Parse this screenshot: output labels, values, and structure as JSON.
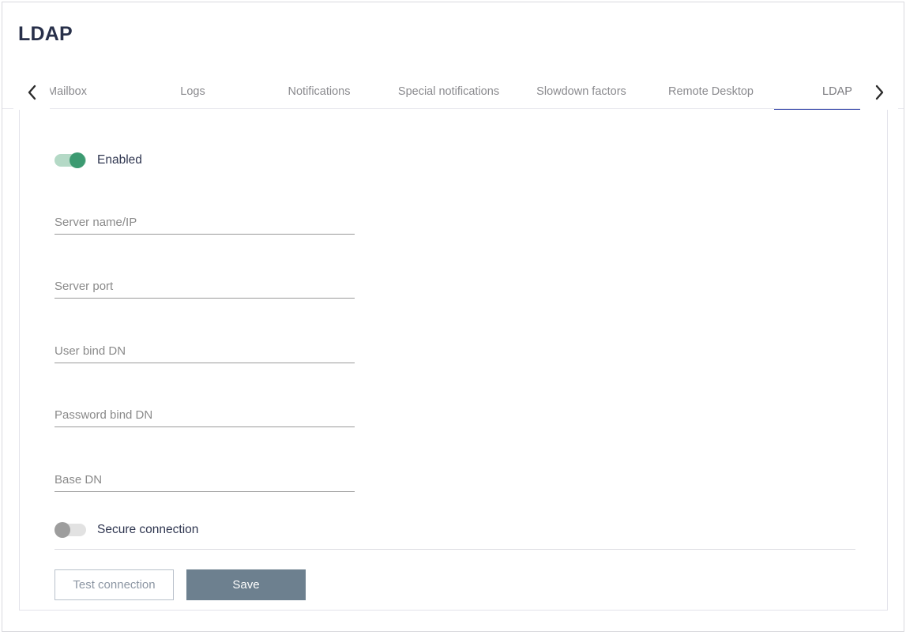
{
  "page": {
    "title": "LDAP"
  },
  "tabbar": {
    "prev_icon": "chevron-left-icon",
    "next_icon": "chevron-right-icon",
    "active_tab": "LDAP",
    "tabs": [
      {
        "label": "Mailbox",
        "active": false
      },
      {
        "label": "Logs",
        "active": false
      },
      {
        "label": "Notifications",
        "active": false
      },
      {
        "label": "Special notifications",
        "active": false
      },
      {
        "label": "Slowdown factors",
        "active": false
      },
      {
        "label": "Remote Desktop",
        "active": false
      },
      {
        "label": "LDAP",
        "active": true
      }
    ]
  },
  "form": {
    "enabled_toggle": {
      "label": "Enabled",
      "state": "on"
    },
    "secure_toggle": {
      "label": "Secure connection",
      "state": "off"
    },
    "fields": [
      {
        "name": "server-name-ip",
        "placeholder": "Server name/IP",
        "value": ""
      },
      {
        "name": "server-port",
        "placeholder": "Server port",
        "value": ""
      },
      {
        "name": "user-bind-dn",
        "placeholder": "User bind DN",
        "value": ""
      },
      {
        "name": "password-bind-dn",
        "placeholder": "Password bind DN",
        "value": ""
      },
      {
        "name": "base-dn",
        "placeholder": "Base DN",
        "value": ""
      }
    ],
    "buttons": {
      "test_label": "Test connection",
      "save_label": "Save"
    }
  },
  "colors": {
    "title": "#28304a",
    "active_tab_underline": "#3949ab",
    "toggle_on_thumb": "#3c9a71",
    "toggle_on_track": "#b4d9c6",
    "toggle_off_thumb": "#9d9d9d",
    "toggle_off_track": "#e2e2e2",
    "save_button": "#6d808f",
    "test_button_border": "#b9c1cb"
  }
}
